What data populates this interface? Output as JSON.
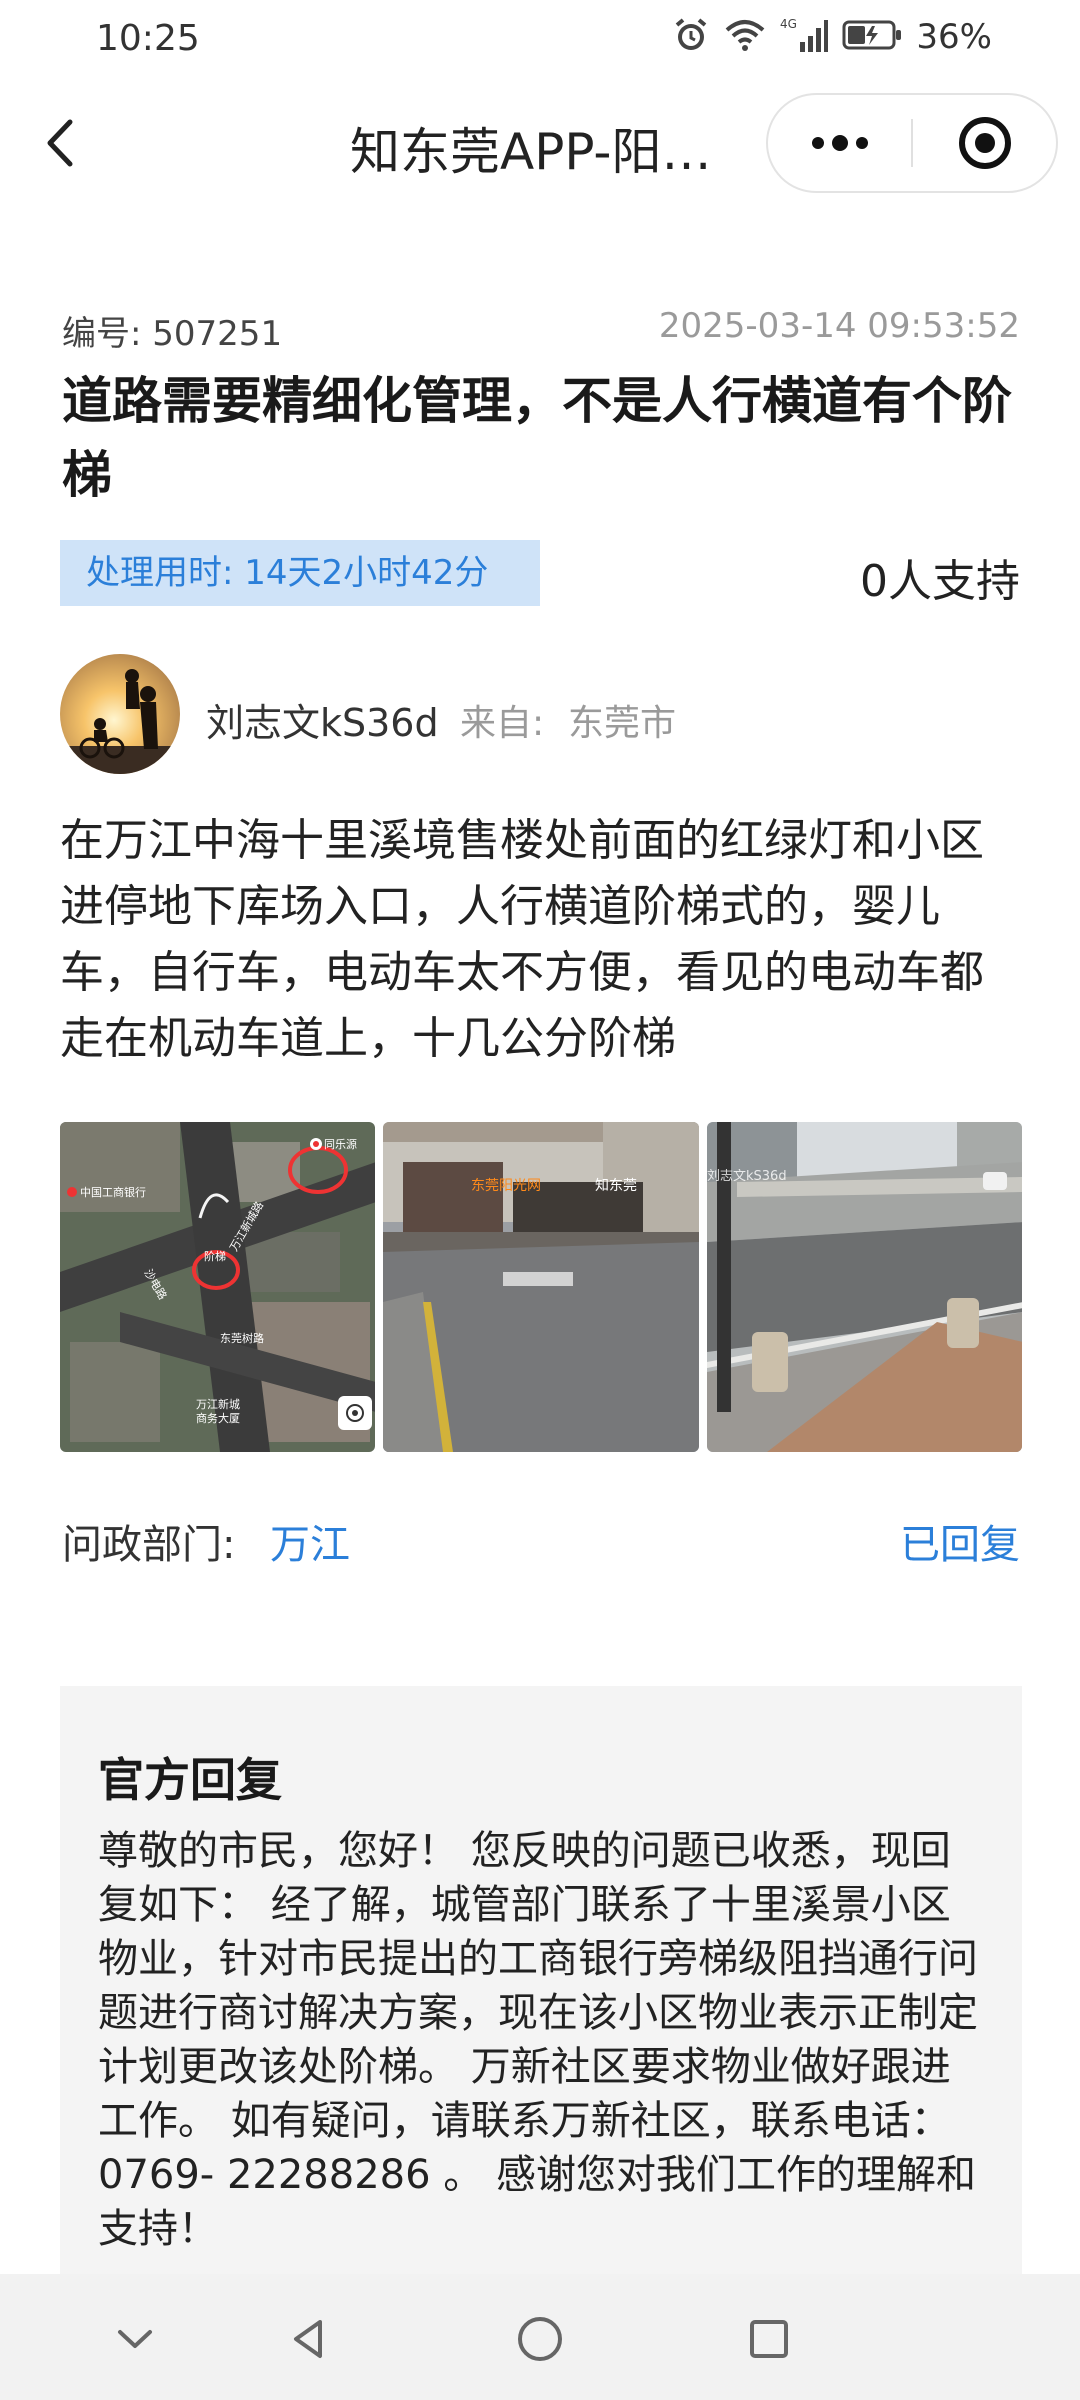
{
  "status_bar": {
    "time": "10:25",
    "network": "4G",
    "battery": "36%",
    "icons": [
      "alarm-icon",
      "wifi-icon",
      "signal-icon",
      "battery-icon"
    ]
  },
  "nav": {
    "title": "知东莞APP-阳…",
    "icons": [
      "back-icon",
      "more-dots-icon",
      "close-target-icon"
    ]
  },
  "issue": {
    "id_label": "编号:",
    "id_value": "507251",
    "timestamp": "2025-03-14 09:53:52",
    "title": "道路需要精细化管理，不是人行横道有个阶梯",
    "duration": "处理用时: 14天2小时42分",
    "support": "0人支持",
    "author": "刘志文kS36d",
    "from_label": "来自:",
    "from_city": "东莞市",
    "body": "在万江中海十里溪境售楼处前面的红绿灯和小区进停地下库场入口，人行横道阶梯式的，婴儿车，自行车，电动车太不方便，看见的电动车都走在机动车道上，十几公分阶梯",
    "dept_label": "问政部门:",
    "dept_value": "万江",
    "reply_status": "已回复"
  },
  "photos": {
    "map_labels": {
      "bank": "中国工商银行",
      "top_right": "同乐源",
      "marker": "阶梯",
      "left_road": "沙电路",
      "mid_road": "万江新城路",
      "bottom_road": "东莞树路",
      "district": "万江新城",
      "district2": "商务大厦"
    },
    "watermarks": {
      "sun": "东莞阳光网",
      "zhi": "知东莞",
      "user": "刘志文kS36d"
    }
  },
  "reply": {
    "title": "官方回复",
    "text": "尊敬的市民，您好！ 您反映的问题已收悉，现回复如下： 经了解，城管部门联系了十里溪景小区物业，针对市民提出的工商银行旁梯级阻挡通行问题进行商讨解决方案，现在该小区物业表示正制定计划更改该处阶梯。 万新社区要求物业做好跟进工作。 如有疑问，请联系万新社区，联系电话：0769- 22288286 。 感谢您对我们工作的理解和支持！"
  },
  "system_nav": {
    "buttons": [
      "collapse-chevron-icon",
      "back-triangle-icon",
      "home-circle-icon",
      "recents-square-icon"
    ]
  }
}
